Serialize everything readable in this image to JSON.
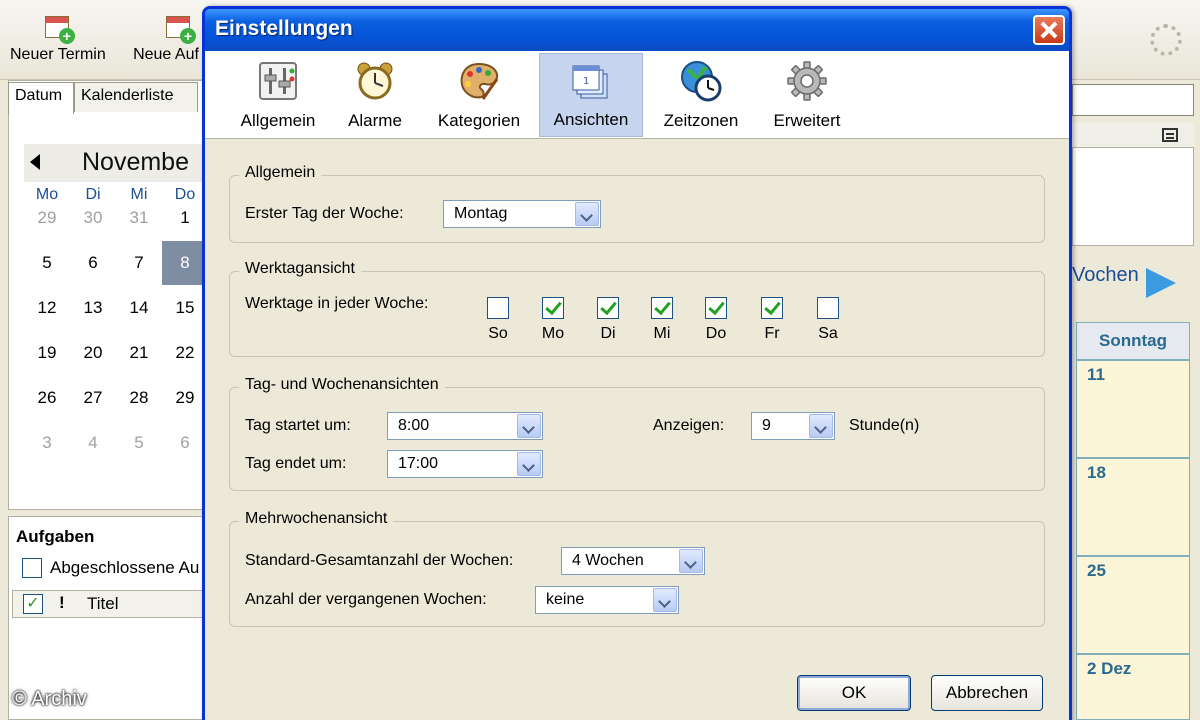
{
  "background": {
    "toolbar": {
      "new_event_label": "Neuer Termin",
      "new_task_label": "Neue Auf"
    },
    "tabs": [
      "Datum",
      "Kalenderliste"
    ],
    "minical": {
      "month": "Novembe",
      "weekdays": [
        "Mo",
        "Di",
        "Mi",
        "Do"
      ],
      "weeks": [
        [
          "29",
          "30",
          "31",
          "1"
        ],
        [
          "5",
          "6",
          "7",
          "8"
        ],
        [
          "12",
          "13",
          "14",
          "15"
        ],
        [
          "19",
          "20",
          "21",
          "22"
        ],
        [
          "26",
          "27",
          "28",
          "29"
        ],
        [
          "3",
          "4",
          "5",
          "6"
        ]
      ],
      "selected_day": "8"
    },
    "tasks": {
      "title": "Aufgaben",
      "show_completed_label": "Abgeschlossene Au",
      "column_priority": "!",
      "column_title": "Titel"
    },
    "right": {
      "weeks_label": "Vochen",
      "column_header": "Sonntag",
      "dates": [
        "11",
        "18",
        "25",
        "2 Dez"
      ]
    },
    "watermark": "© Archiv"
  },
  "dialog": {
    "title": "Einstellungen",
    "categories": [
      {
        "label": "Allgemein",
        "icon": "sliders-icon"
      },
      {
        "label": "Alarme",
        "icon": "alarm-clock-icon"
      },
      {
        "label": "Kategorien",
        "icon": "palette-icon"
      },
      {
        "label": "Ansichten",
        "icon": "views-icon"
      },
      {
        "label": "Zeitzonen",
        "icon": "globe-clock-icon"
      },
      {
        "label": "Erweitert",
        "icon": "gear-icon"
      }
    ],
    "active_category": "Ansichten",
    "general": {
      "group_title": "Allgemein",
      "first_day_label": "Erster Tag der Woche:",
      "first_day_value": "Montag"
    },
    "workdays": {
      "group_title": "Werktagansicht",
      "label": "Werktage in jeder Woche:",
      "days": [
        {
          "label": "So",
          "checked": false
        },
        {
          "label": "Mo",
          "checked": true
        },
        {
          "label": "Di",
          "checked": true
        },
        {
          "label": "Mi",
          "checked": true
        },
        {
          "label": "Do",
          "checked": true
        },
        {
          "label": "Fr",
          "checked": true
        },
        {
          "label": "Sa",
          "checked": false
        }
      ]
    },
    "dayweek": {
      "group_title": "Tag- und Wochenansichten",
      "start_label": "Tag startet um:",
      "start_value": "8:00",
      "end_label": "Tag endet um:",
      "end_value": "17:00",
      "show_label": "Anzeigen:",
      "show_value": "9",
      "hours_label": "Stunde(n)"
    },
    "multiweek": {
      "group_title": "Mehrwochenansicht",
      "total_label": "Standard-Gesamtanzahl der Wochen:",
      "total_value": "4 Wochen",
      "past_label": "Anzahl der vergangenen Wochen:",
      "past_value": "keine"
    },
    "buttons": {
      "ok": "OK",
      "cancel": "Abbrechen"
    }
  }
}
